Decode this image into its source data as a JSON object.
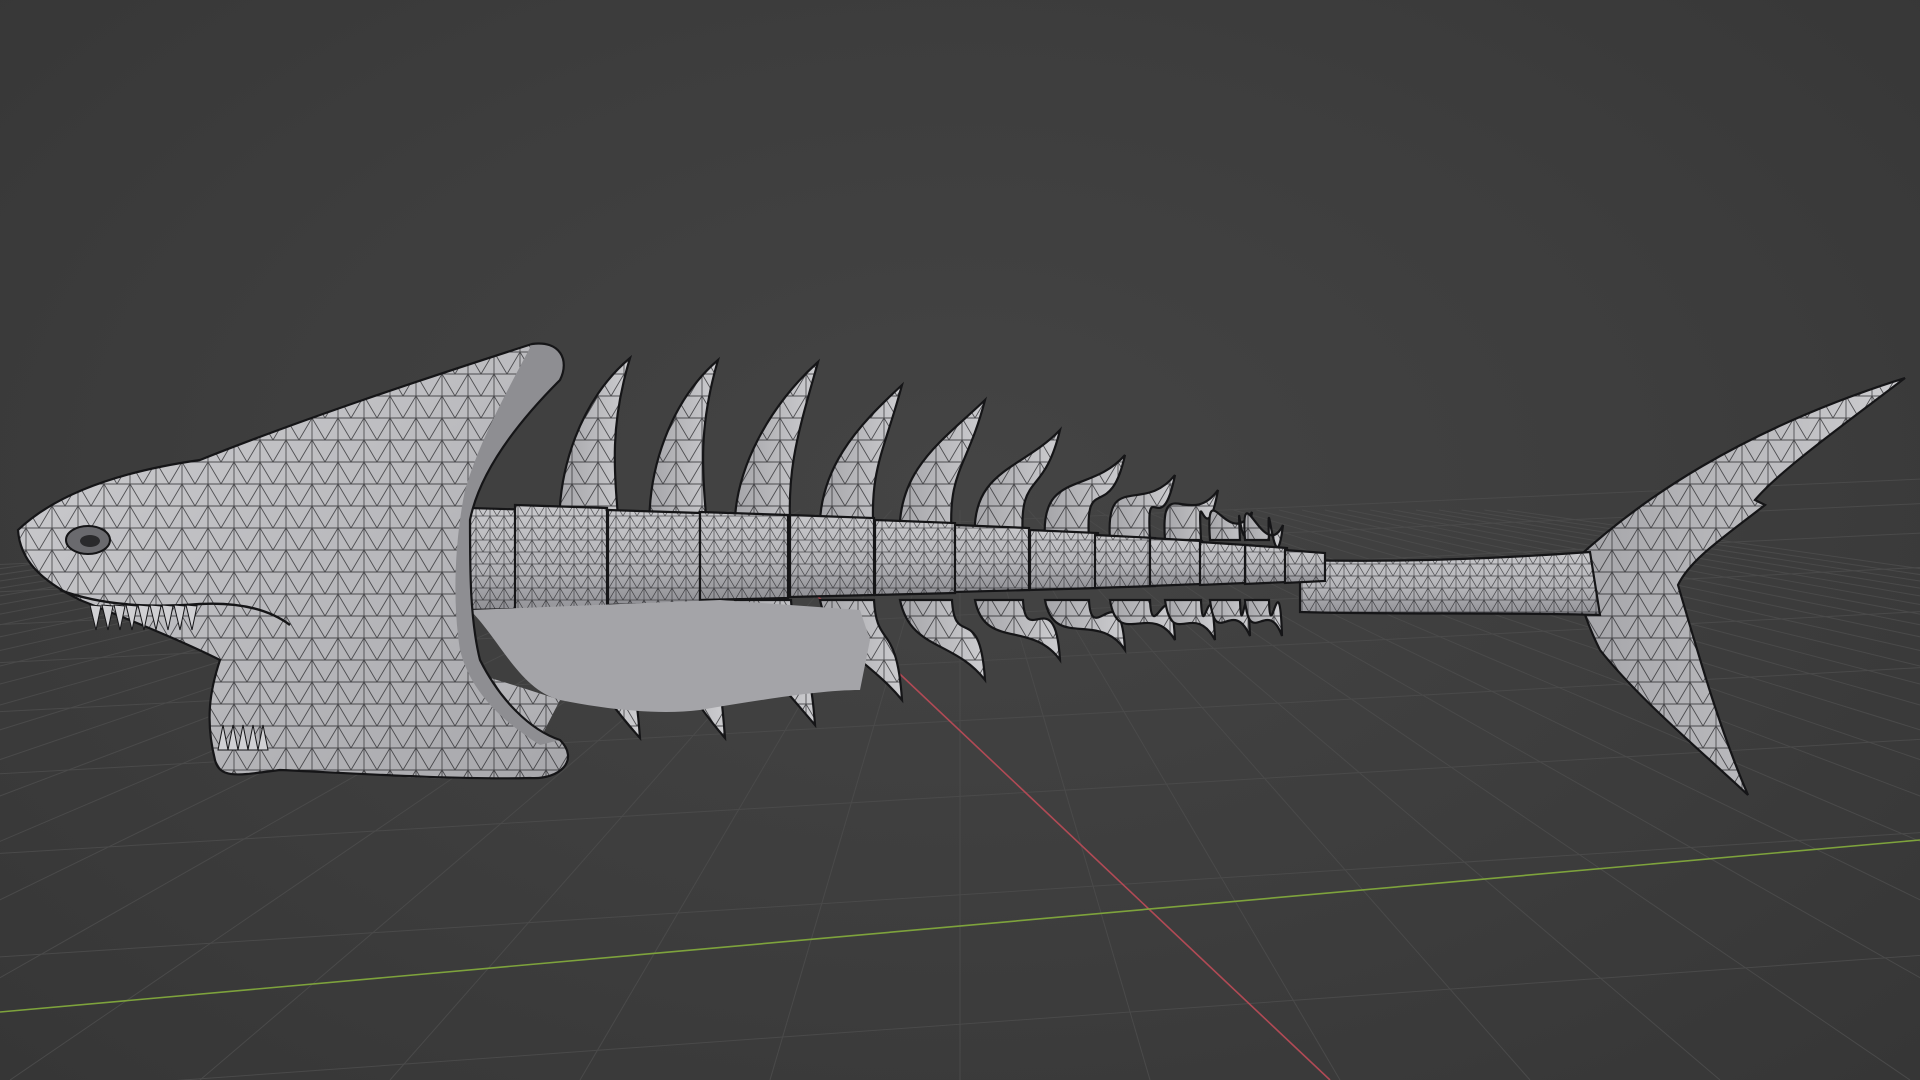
{
  "viewport": {
    "background": "#3d3d3d",
    "grid_color": "#4a4a4a",
    "x_axis_color": "#b14a55",
    "y_axis_color": "#7ea33c"
  },
  "object": {
    "name": "",
    "shading": "solid-wireframe",
    "mesh_color": "#b9b9bc",
    "wire_color": "#1d1d1f",
    "icon": "skeleton-shark-mesh"
  }
}
